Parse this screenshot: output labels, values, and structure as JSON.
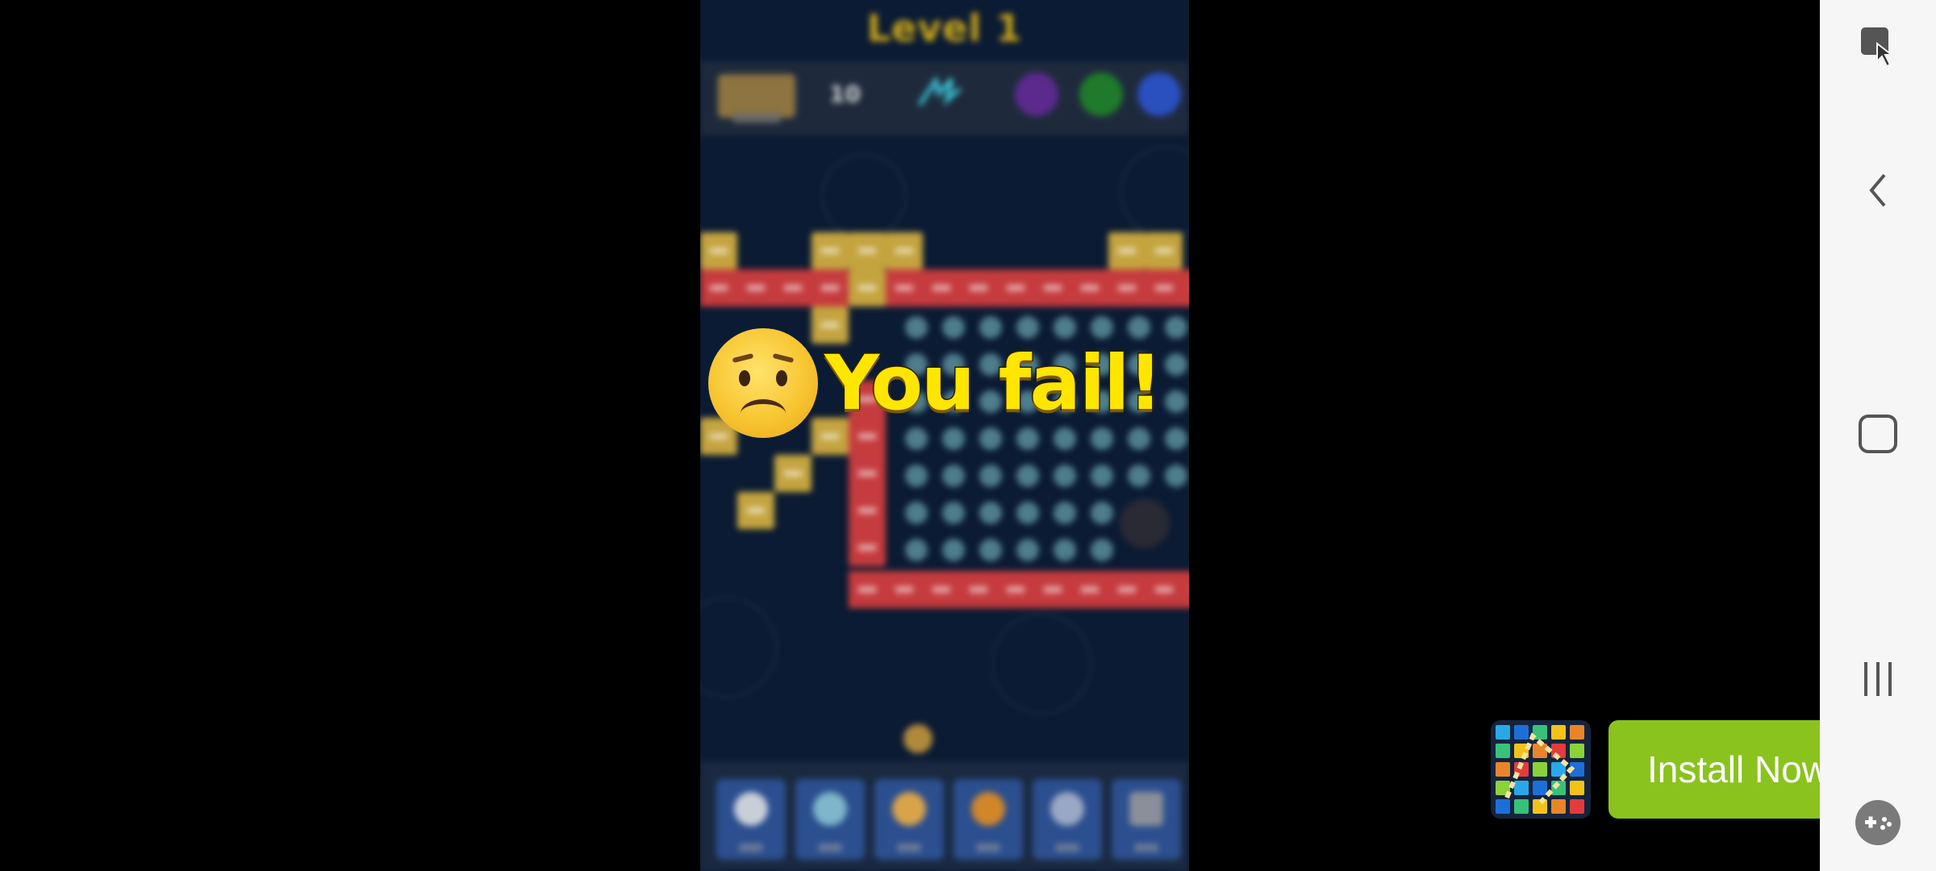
{
  "game": {
    "level_title": "Level 1",
    "score": "10",
    "result_text": "You fail!",
    "result_emoji": "sad-face-emoji"
  },
  "ad": {
    "install_label": "Install Now",
    "app_icon": "block-puzzle-app-icon"
  },
  "system_nav": {
    "screenshot_icon": "touch-screenshot-icon",
    "back_icon": "chevron-left-icon",
    "home_icon": "square-home-icon",
    "recents_icon": "recents-icon",
    "game_tools_icon": "gamepad-icon"
  },
  "colors": {
    "fail_text": "#ffe600",
    "install_button": "#8ac31d",
    "board_bg": "#0b1b33"
  }
}
